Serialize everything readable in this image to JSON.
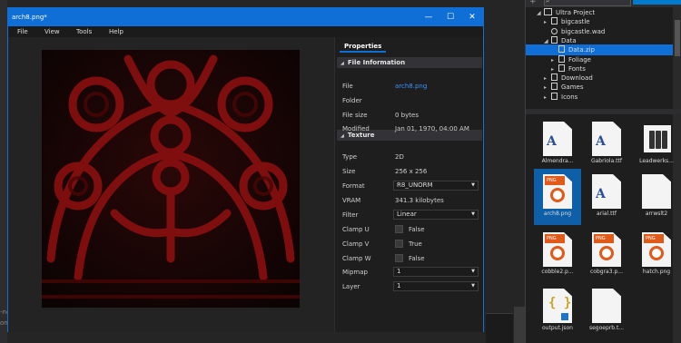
{
  "window": {
    "title": "arch8.png*",
    "minimize_glyph": "—",
    "maximize_glyph": "☐",
    "close_glyph": "✕"
  },
  "menu": [
    "File",
    "View",
    "Tools",
    "Help"
  ],
  "properties": {
    "tab": "Properties",
    "file_section": "File Information",
    "texture_section": "Texture",
    "file_rows": [
      {
        "label": "File",
        "value": "arch8.png"
      },
      {
        "label": "Folder",
        "value": ""
      },
      {
        "label": "File size",
        "value": "0 bytes"
      },
      {
        "label": "Modified",
        "value": "Jan 01, 1970, 04:00 AM"
      }
    ],
    "texture_rows": [
      {
        "label": "Type",
        "value": "2D"
      },
      {
        "label": "Size",
        "value": "256 x 256"
      },
      {
        "label": "Format",
        "value": "R8_UNORM"
      },
      {
        "label": "VRAM",
        "value": "341.3 kilobytes"
      },
      {
        "label": "Filter",
        "value": "Linear"
      },
      {
        "label": "Clamp U",
        "value": "False"
      },
      {
        "label": "Clamp V",
        "value": "True"
      },
      {
        "label": "Clamp W",
        "value": "False"
      },
      {
        "label": "Mipmap",
        "value": "1"
      },
      {
        "label": "Layer",
        "value": "1"
      }
    ],
    "checks": {
      "clamp_u": false,
      "clamp_v": false,
      "clamp_w": false
    }
  },
  "tree": [
    {
      "label": "Ultra Project",
      "arrow": "◢",
      "indent": 1,
      "icon": "folder-icon"
    },
    {
      "label": "bigcastle",
      "arrow": "▸",
      "indent": 2,
      "icon": "file-icon"
    },
    {
      "label": "bigcastle.wad",
      "arrow": "",
      "indent": 2,
      "icon": "package-icon"
    },
    {
      "label": "Data",
      "arrow": "◢",
      "indent": 2,
      "icon": "file-icon"
    },
    {
      "label": "Data.zip",
      "arrow": "",
      "indent": 3,
      "icon": "file-icon",
      "selected": true
    },
    {
      "label": "Foliage",
      "arrow": "▸",
      "indent": 3,
      "icon": "file-icon"
    },
    {
      "label": "Fonts",
      "arrow": "▸",
      "indent": 3,
      "icon": "file-icon"
    },
    {
      "label": "Download",
      "arrow": "▸",
      "indent": 2,
      "icon": "file-icon"
    },
    {
      "label": "Games",
      "arrow": "▸",
      "indent": 2,
      "icon": "file-icon"
    },
    {
      "label": "Icons",
      "arrow": "▸",
      "indent": 2,
      "icon": "file-icon"
    }
  ],
  "assets": [
    {
      "label": "Almendra...",
      "kind": "font"
    },
    {
      "label": "Gabriola.ttf",
      "kind": "font"
    },
    {
      "label": "Leadwerks...",
      "kind": "books"
    },
    {
      "label": "arch8.png",
      "kind": "png",
      "selected": true
    },
    {
      "label": "arial.ttf",
      "kind": "font"
    },
    {
      "label": "arrwslt2",
      "kind": "blank"
    },
    {
      "label": "cobble2.p...",
      "kind": "png"
    },
    {
      "label": "cobgra3.p...",
      "kind": "png"
    },
    {
      "label": "hatch.png",
      "kind": "png"
    },
    {
      "label": "output.json",
      "kind": "json"
    },
    {
      "label": "segoeprb.t...",
      "kind": "blank"
    }
  ],
  "icons": {
    "font_glyph": "A",
    "png_badge": "PNG",
    "json_glyph": "{ }",
    "search_glyph": "⌕",
    "add_glyph": "+"
  },
  "background": {
    "bottom_text": [
      "-nd",
      "onds"
    ]
  },
  "colors": {
    "accent": "#0f6fd6",
    "texture_red": "#8a0f0f",
    "link": "#3794ff"
  }
}
